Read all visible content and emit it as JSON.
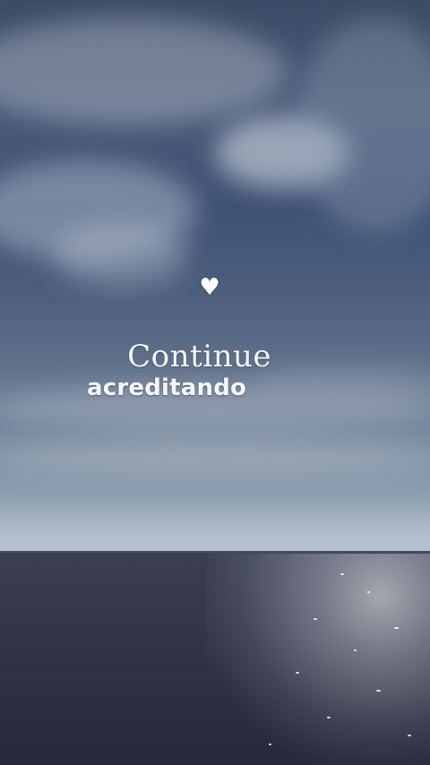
{
  "overlay": {
    "heart_icon": "white-heart-icon",
    "line1": "Continue",
    "line2": "acreditando"
  },
  "colors": {
    "sky_top": "#3c4b66",
    "sky_horizon": "#a5b2c2",
    "sea": "#2b2f3f",
    "text": "#f4f6fa"
  }
}
